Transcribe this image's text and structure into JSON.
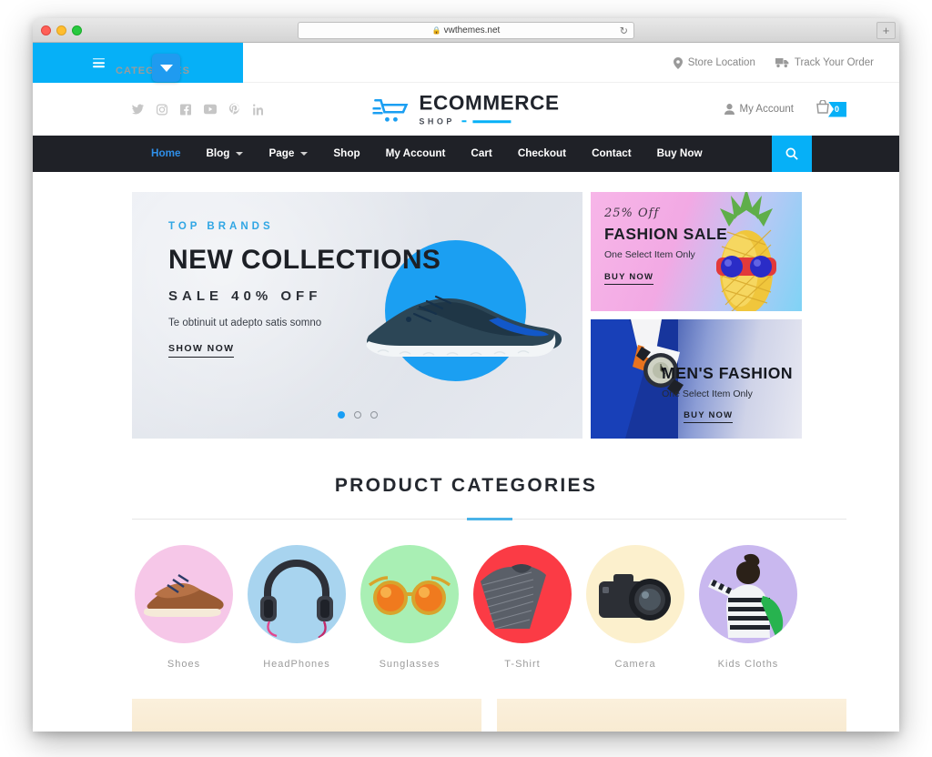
{
  "browser": {
    "url": "vwthemes.net",
    "lock_icon": "lock-icon",
    "reload_icon": "reload-icon",
    "new_tab_icon": "plus-icon"
  },
  "download_chip": {
    "icon": "download-triangle-icon"
  },
  "topbar": {
    "categories_label": "CATEGORIES",
    "store_location": "Store Location",
    "track_order": "Track Your Order"
  },
  "social": [
    {
      "name": "twitter-icon"
    },
    {
      "name": "instagram-icon"
    },
    {
      "name": "facebook-icon"
    },
    {
      "name": "youtube-icon"
    },
    {
      "name": "pinterest-icon"
    },
    {
      "name": "linkedin-icon"
    }
  ],
  "logo": {
    "brand": "ECOMMERCE",
    "sub": "SHOP",
    "cart_icon": "shopping-cart-icon"
  },
  "account": {
    "my_account": "My Account",
    "cart_count": "0",
    "bag_icon": "shopping-bag-icon",
    "user_icon": "user-icon"
  },
  "nav": {
    "items": [
      {
        "label": "Home",
        "active": true,
        "caret": false
      },
      {
        "label": "Blog",
        "active": false,
        "caret": true
      },
      {
        "label": "Page",
        "active": false,
        "caret": true
      },
      {
        "label": "Shop",
        "active": false,
        "caret": false
      },
      {
        "label": "My Account",
        "active": false,
        "caret": false
      },
      {
        "label": "Cart",
        "active": false,
        "caret": false
      },
      {
        "label": "Checkout",
        "active": false,
        "caret": false
      },
      {
        "label": "Contact",
        "active": false,
        "caret": false
      },
      {
        "label": "Buy Now",
        "active": false,
        "caret": false
      }
    ],
    "search_icon": "search-icon"
  },
  "hero": {
    "eyebrow": "TOP BRANDS",
    "headline": "NEW COLLECTIONS",
    "subline": "SALE 40% OFF",
    "description": "Te obtinuit ut adepto satis somno",
    "cta": "SHOW NOW",
    "slides_total": 3,
    "active_slide": 1
  },
  "banners": [
    {
      "pct": "25% Off",
      "title": "FASHION SALE",
      "sub": "One Select Item Only",
      "cta": "BUY NOW"
    },
    {
      "title": "MEN'S FASHION",
      "sub": "One Select Item Only",
      "cta": "BUY NOW"
    }
  ],
  "categories_section": {
    "title": "PRODUCT CATEGORIES",
    "items": [
      {
        "label": "Shoes",
        "bg": "#f6c7e8"
      },
      {
        "label": "HeadPhones",
        "bg": "#a8d4ef"
      },
      {
        "label": "Sunglasses",
        "bg": "#a9efb4"
      },
      {
        "label": "T-Shirt",
        "bg": "#fb3b45"
      },
      {
        "label": "Camera",
        "bg": "#fcf0cd"
      },
      {
        "label": "Kids Cloths",
        "bg": "#c9b8ef"
      }
    ]
  },
  "colors": {
    "accent_blue": "#06b0f7",
    "nav_dark": "#1f2127",
    "active_link": "#2f8fe8"
  }
}
